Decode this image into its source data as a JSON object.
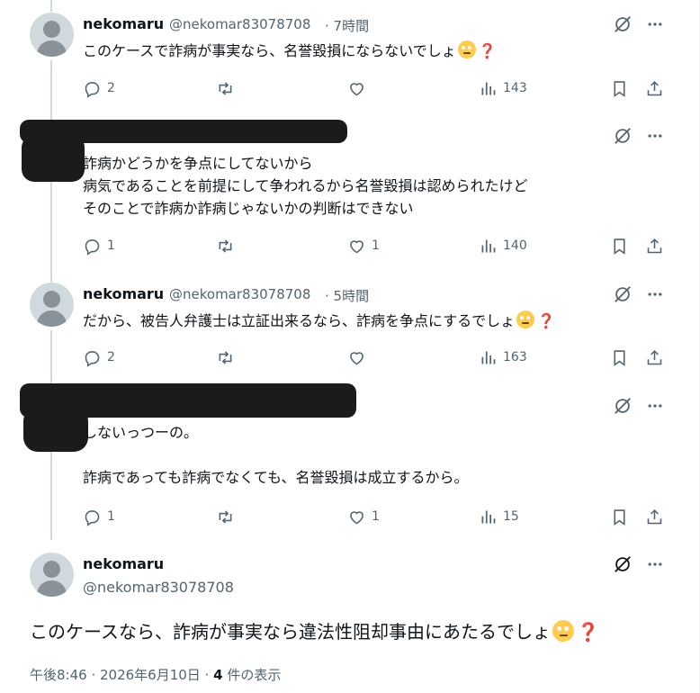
{
  "replies": [
    {
      "name": "nekomaru",
      "handle": "@nekomar83078708",
      "time": "· 7時間",
      "lines": [
        "このケースで詐病が事実なら、名誉毀損にならないでしょ"
      ],
      "has_emoji": true,
      "stats": {
        "replies": "2",
        "reposts": "",
        "likes": "",
        "views": "143"
      }
    },
    {
      "name": "",
      "handle": "",
      "time": "",
      "lines": [
        "詐病かどうかを争点にしてないから",
        "病気であることを前提にして争われるから名誉毀損は認められたけど",
        "そのことで詐病か詐病じゃないかの判断はできない"
      ],
      "has_emoji": false,
      "stats": {
        "replies": "1",
        "reposts": "",
        "likes": "1",
        "views": "140"
      }
    },
    {
      "name": "nekomaru",
      "handle": "@nekomar83078708",
      "time": "· 5時間",
      "lines": [
        "だから、被告人弁護士は立証出来るなら、詐病を争点にするでしょ"
      ],
      "has_emoji": true,
      "stats": {
        "replies": "2",
        "reposts": "",
        "likes": "",
        "views": "163"
      }
    },
    {
      "name": "",
      "handle": "",
      "time": "",
      "lines": [
        "しないっつーの。",
        "",
        "詐病であっても詐病でなくても、名誉毀損は成立するから。"
      ],
      "has_emoji": false,
      "stats": {
        "replies": "1",
        "reposts": "",
        "likes": "1",
        "views": "15"
      }
    }
  ],
  "main_post": {
    "name": "nekomaru",
    "handle": "@nekomar83078708",
    "text": "このケースなら、詐病が事実なら違法性阻却事由にあたるでしょ",
    "qmark": "❓",
    "time": "午後8:46 · 2026年6月10日 · ",
    "views_count": "4",
    "views_label": " 件の表示"
  },
  "qmark": "❓",
  "icons": {
    "grok": "grok-icon",
    "more": "more-icon",
    "reply": "reply-icon",
    "repost": "repost-icon",
    "like": "like-icon",
    "views": "views-icon",
    "bookmark": "bookmark-icon",
    "share": "share-icon"
  },
  "colors": {
    "text": "#0f1419",
    "secondary": "#536471",
    "line": "#cfd9de",
    "emoji": "#ffcc4d",
    "qmark": "#dd2e44"
  }
}
